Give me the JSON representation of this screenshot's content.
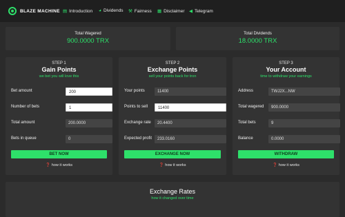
{
  "nav": {
    "brand": "BLAZE MACHINE",
    "links": [
      {
        "label": "Introduction",
        "icon": "book-icon"
      },
      {
        "label": "Dividends",
        "icon": "pie-chart-icon"
      },
      {
        "label": "Fairness",
        "icon": "gavel-icon"
      },
      {
        "label": "Disclaimer",
        "icon": "file-icon"
      },
      {
        "label": "Telegram",
        "icon": "send-icon"
      }
    ]
  },
  "stats": {
    "wagered_label": "Total Wagered",
    "wagered_value": "900.0000 TRX",
    "dividends_label": "Total Dividends",
    "dividends_value": "18.0000 TRX"
  },
  "panels": {
    "gain": {
      "step": "STEP 1",
      "title": "Gain Points",
      "subtitle": "we bet you will love this",
      "bet_amount_label": "Bet amount",
      "bet_amount_value": "200",
      "num_bets_label": "Number of bets",
      "num_bets_value": "1",
      "total_amount_label": "Total amount",
      "total_amount_value": "200.0000",
      "bets_queue_label": "Bets in queue",
      "bets_queue_value": "0",
      "button": "BET NOW",
      "how": "how it works"
    },
    "exchange": {
      "step": "STEP 2",
      "title": "Exchange Points",
      "subtitle": "sell your points back for tron",
      "your_points_label": "Your points",
      "your_points_value": "11400",
      "points_sell_label": "Points to sell",
      "points_sell_value": "11400",
      "rate_label": "Exchange rate",
      "rate_value": "20.4400",
      "profit_label": "Expected profit",
      "profit_value": "233.0160",
      "button": "EXCHANGE NOW",
      "how": "how it works"
    },
    "account": {
      "step": "STEP 3",
      "title": "Your Account",
      "subtitle": "time to withdraw your earnings",
      "address_label": "Address",
      "address_value": "TWJ2X...NW",
      "wagered_label": "Total wagered",
      "wagered_value": "900.0000",
      "bets_label": "Total bets",
      "bets_value": "9",
      "balance_label": "Balance",
      "balance_value": "0.0000",
      "button": "WITHDRAW",
      "how": "how it works"
    }
  },
  "rates": {
    "title": "Exchange Rates",
    "subtitle": "how it changed over time"
  },
  "colors": {
    "accent": "#2ee06a",
    "background": "#2b2b2b",
    "card": "#333333",
    "navbar": "#1f1f1f"
  }
}
